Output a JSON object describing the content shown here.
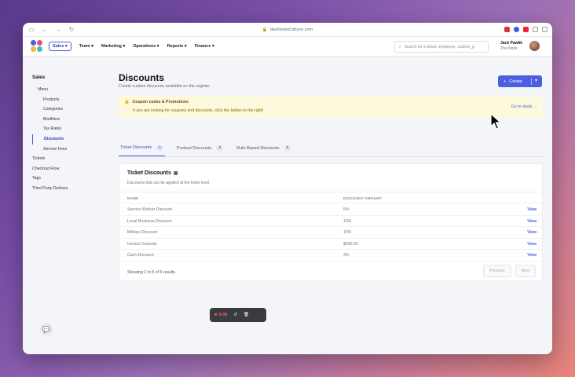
{
  "browser": {
    "url": "dashboard.drtyvo.com"
  },
  "app": {
    "nav": [
      "Sales",
      "Team",
      "Marketing",
      "Operations",
      "Reports",
      "Finance"
    ],
    "search_placeholder": "Search for a ticket, employee, custom_p",
    "user_name": "Jack Pawlik",
    "user_org": "The Nook"
  },
  "sidebar": {
    "title": "Sales",
    "items": [
      {
        "label": "Menu",
        "level": "menu"
      },
      {
        "label": "Products",
        "level": "sub"
      },
      {
        "label": "Categories",
        "level": "sub"
      },
      {
        "label": "Modifiers",
        "level": "sub"
      },
      {
        "label": "Tax Rates",
        "level": "sub"
      },
      {
        "label": "Discounts",
        "level": "sub",
        "active": true
      },
      {
        "label": "Service Fees",
        "level": "sub"
      },
      {
        "label": "Tickets",
        "level": "top"
      },
      {
        "label": "Checkout Flow",
        "level": "top"
      },
      {
        "label": "Tags",
        "level": "top"
      },
      {
        "label": "Third Party Delivery",
        "level": "top"
      }
    ]
  },
  "page": {
    "title": "Discounts",
    "subtitle": "Create custom discounts available on the register",
    "create_label": "Create"
  },
  "banner": {
    "title": "Coupon codes & Promotions",
    "text": "If you are looking for coupons and discounts, click the button to the right!",
    "link": "Go to deals →"
  },
  "tabs": [
    {
      "label": "Ticket Discounts",
      "count": "5",
      "active": true
    },
    {
      "label": "Product Discounts",
      "count": "3",
      "active": false
    },
    {
      "label": "Rule-Based Discounts",
      "count": "0",
      "active": false
    }
  ],
  "table": {
    "title": "Ticket Discounts",
    "subtitle": "Discounts that can be applied at the ticket level",
    "headers": [
      "NAME",
      "DISCOUNT AMOUNT"
    ],
    "rows": [
      {
        "name": "Service Worker Discount",
        "amount": "5%",
        "action": "View"
      },
      {
        "name": "Local Business Discount",
        "amount": "10%",
        "action": "View"
      },
      {
        "name": "Military Discount",
        "amount": "10%",
        "action": "View"
      },
      {
        "name": "Invoice Deposits",
        "amount": "$500.00",
        "action": "View"
      },
      {
        "name": "Cash Discount",
        "amount": "3%",
        "action": "View"
      }
    ],
    "footer": "Showing 1 to 5 of 5 results",
    "prev_label": "Previous",
    "next_label": "Next"
  },
  "recorder": {
    "stop_label": "0:00"
  },
  "colors": {
    "accent": "#4c5fe3",
    "banner_bg": "#fdf9dc"
  }
}
